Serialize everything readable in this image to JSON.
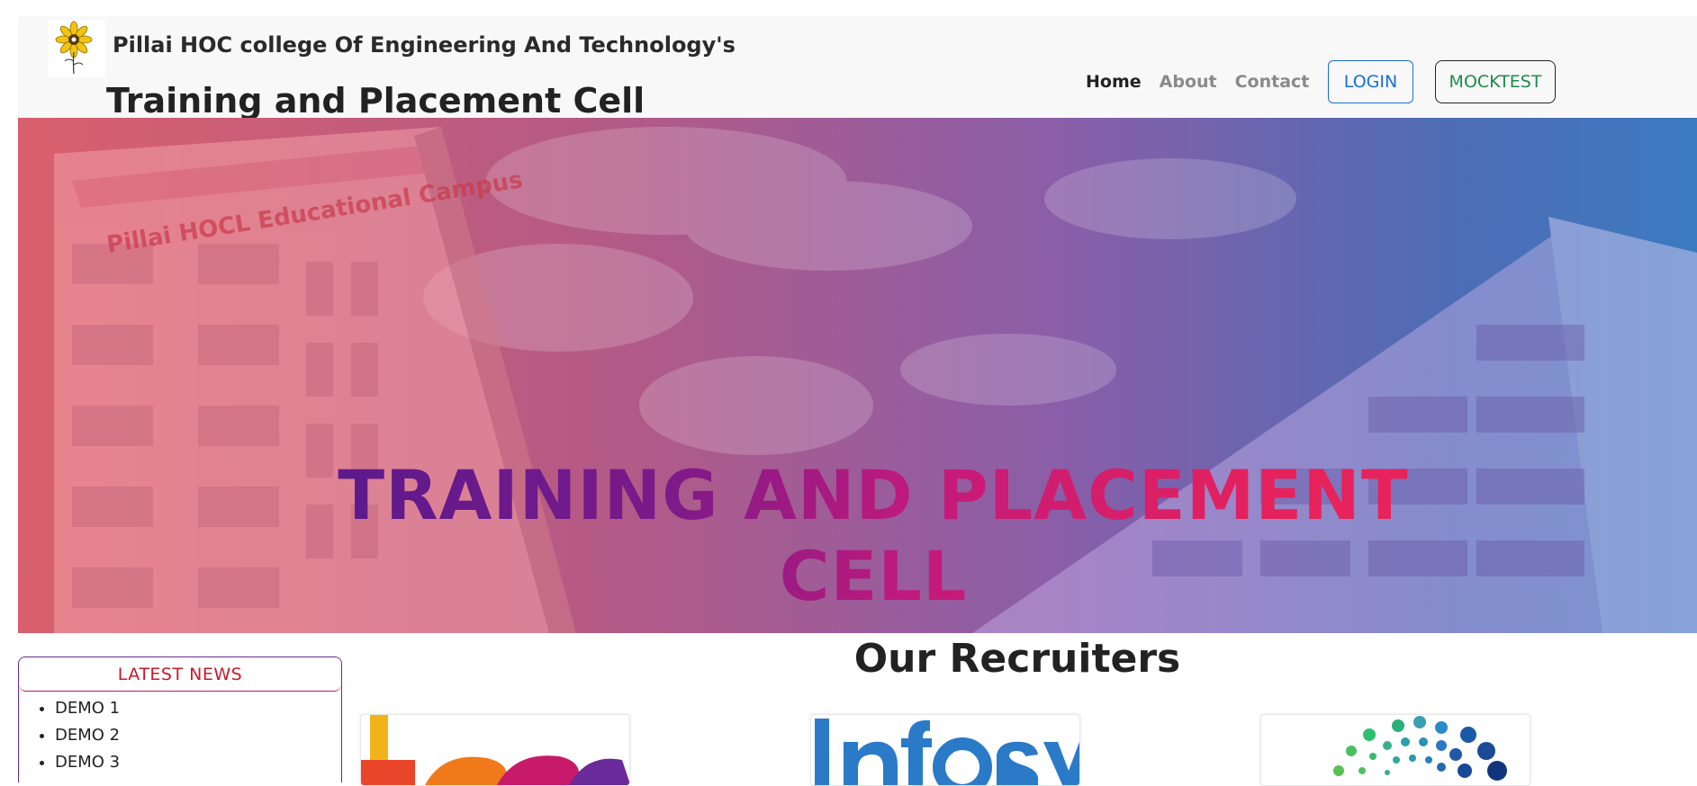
{
  "header": {
    "college_name": "Pillai HOC college Of Engineering And Technology's",
    "cell_title": "Training and Placement Cell",
    "logo_icon": "sunflower-logo-icon"
  },
  "nav": {
    "items": [
      {
        "label": "Home",
        "active": true
      },
      {
        "label": "About",
        "active": false
      },
      {
        "label": "Contact",
        "active": false
      }
    ],
    "login_label": "LOGIN",
    "mocktest_label": "MOCKTEST"
  },
  "hero": {
    "title": "TRAINING AND PLACEMENT CELL",
    "sign_text": "Pillai HOCL Educational Campus"
  },
  "news": {
    "heading": "LATEST NEWS",
    "items": [
      "DEMO 1",
      "DEMO 2",
      "DEMO 3"
    ]
  },
  "recruiters": {
    "heading": "Our Recruiters",
    "cards": [
      {
        "name": "TCS",
        "logo_icon": "tcs-logo-icon"
      },
      {
        "name": "Infosys",
        "logo_icon": "infosys-logo-icon"
      },
      {
        "name": "dotted-circle-logo",
        "logo_icon": "dots-logo-icon"
      }
    ]
  },
  "colors": {
    "login": "#1a6fd6",
    "mocktest": "#1e8a4c",
    "news_heading": "#c41a2a",
    "news_border": "#6b2a8c"
  }
}
